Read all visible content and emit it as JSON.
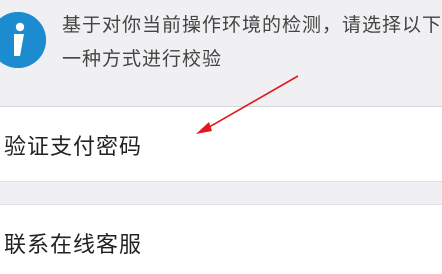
{
  "notice": {
    "icon": "info-icon",
    "text": "基于对你当前操作环境的检测，请选择以下一种方式进行校验"
  },
  "options": [
    {
      "label": "验证支付密码"
    },
    {
      "label": "联系在线客服"
    }
  ],
  "colors": {
    "icon_blue": "#1d8bcf",
    "arrow_red": "#e0191f",
    "background": "#efeff4"
  }
}
